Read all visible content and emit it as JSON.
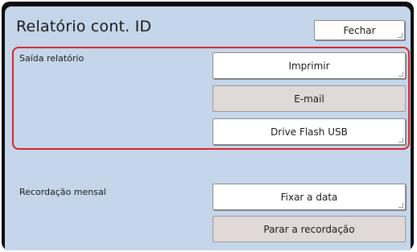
{
  "header": {
    "title": "Relatório cont. ID",
    "close_label": "Fechar"
  },
  "report_output": {
    "label": "Saída relatório",
    "print_label": "Imprimir",
    "email_label": "E-mail",
    "usb_label": "Drive Flash USB"
  },
  "monthly_recording": {
    "label": "Recordação mensal",
    "set_date_label": "Fixar a data",
    "stop_label": "Parar a recordação"
  },
  "colors": {
    "panel": "#c5d6ea",
    "highlight": "#d8262b",
    "disabled_button": "#e1d8d8"
  }
}
